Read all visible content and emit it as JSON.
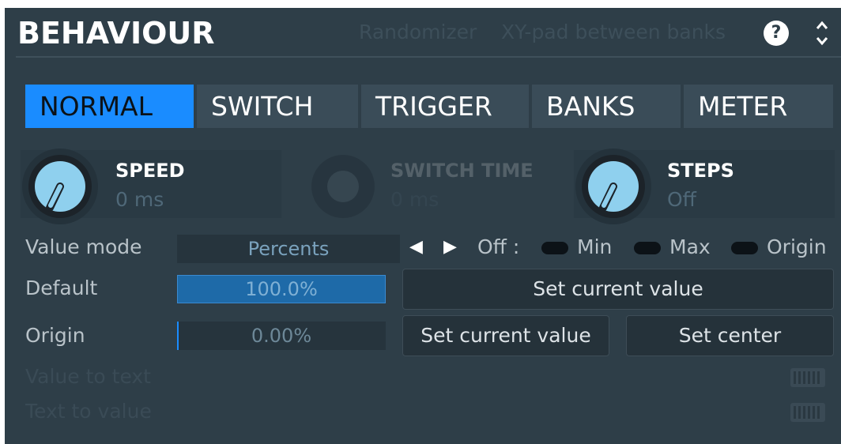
{
  "header": {
    "title": "BEHAVIOUR",
    "links": [
      "Randomizer",
      "XY-pad between banks"
    ],
    "help_glyph": "?",
    "collapse_icon": "up-down-chevron-icon"
  },
  "tabs": [
    {
      "label": "NORMAL",
      "active": true
    },
    {
      "label": "SWITCH",
      "active": false
    },
    {
      "label": "TRIGGER",
      "active": false
    },
    {
      "label": "BANKS",
      "active": false
    },
    {
      "label": "METER",
      "active": false
    }
  ],
  "knobs": [
    {
      "label": "SPEED",
      "value": "0 ms",
      "enabled": true
    },
    {
      "label": "SWITCH TIME",
      "value": "0 ms",
      "enabled": false
    },
    {
      "label": "STEPS",
      "value": "Off",
      "enabled": true
    }
  ],
  "value_mode": {
    "label": "Value mode",
    "value": "Percents",
    "prev_glyph": "◀",
    "next_glyph": "▶",
    "off_label": "Off :",
    "options": [
      "Min",
      "Max",
      "Origin"
    ]
  },
  "default": {
    "label": "Default",
    "value": "100.0%",
    "fill_fraction": 1.0,
    "button": "Set current value"
  },
  "origin": {
    "label": "Origin",
    "value": "0.00%",
    "fill_fraction": 0.0,
    "button_current": "Set current value",
    "button_center": "Set center"
  },
  "value_to_text": {
    "label": "Value to text",
    "icon": "keyboard-icon"
  },
  "text_to_value": {
    "label": "Text to value",
    "icon": "keyboard-icon"
  },
  "colors": {
    "panel": "#2e3e48",
    "accent": "#1a8cff",
    "knob_face": "#8fd0ee",
    "default_fill": "#1e6aa8"
  }
}
